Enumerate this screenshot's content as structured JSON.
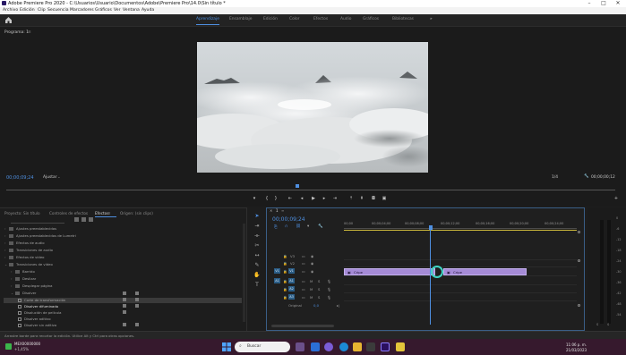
{
  "window": {
    "title": "Adobe Premiere Pro 2020 - C:\\Usuarios\\Usuario\\Documentos\\Adobe\\Premiere Pro\\14.0\\Sin título *",
    "minimize": "–",
    "maximize": "□",
    "close": "✕"
  },
  "menu": [
    "Archivo",
    "Edición",
    "Clip",
    "Secuencia",
    "Marcadores",
    "Gráficos",
    "Ver",
    "Ventana",
    "Ayuda"
  ],
  "workspaces": {
    "items": [
      "Aprendizaje",
      "Ensamblaje",
      "Edición",
      "Color",
      "Efectos",
      "Audio",
      "Gráficos",
      "Bibliotecas"
    ],
    "active_index": 0,
    "more": "»"
  },
  "program_monitor": {
    "title": "Programa: 1",
    "timecode": "00;00;09;24",
    "fit": "Ajustar",
    "resolution": "1/4",
    "duration": "00;00;00;12"
  },
  "effects_panel": {
    "tabs": [
      "Proyecto: Sin título",
      "Controles de efectos",
      "Efectos",
      "Origen: (sin clips)"
    ],
    "active_tab": 2,
    "tree": [
      {
        "label": "Ajustes preestablecidos",
        "type": "folder",
        "level": 0
      },
      {
        "label": "Ajustes preestablecidos de Lumetri",
        "type": "folder",
        "level": 0
      },
      {
        "label": "Efectos de audio",
        "type": "folder",
        "level": 0
      },
      {
        "label": "Transiciones de audio",
        "type": "folder",
        "level": 0
      },
      {
        "label": "Efectos de vídeo",
        "type": "folder",
        "level": 0
      },
      {
        "label": "Transiciones de vídeo",
        "type": "folder",
        "level": 0
      },
      {
        "label": "Barrido",
        "type": "folder",
        "level": 1
      },
      {
        "label": "Deslizar",
        "type": "folder",
        "level": 1
      },
      {
        "label": "Desplegar página",
        "type": "folder",
        "level": 1
      },
      {
        "label": "Disolver",
        "type": "folder",
        "level": 1
      },
      {
        "label": "Corte de transformación",
        "type": "effect",
        "level": 2
      },
      {
        "label": "Disolver difuminado",
        "type": "effect",
        "level": 2,
        "selected": true
      },
      {
        "label": "Disolución de película",
        "type": "effect",
        "level": 2
      },
      {
        "label": "Disolver aditivo",
        "type": "effect",
        "level": 2
      },
      {
        "label": "Disolver sin aditivo",
        "type": "effect",
        "level": 2
      }
    ]
  },
  "timeline": {
    "close": "✕",
    "sequence_name": "1",
    "timecode": "00;00;09;24",
    "ruler": [
      "00;00",
      "00;00;04;00",
      "00;00;08;00",
      "00;00;12;00",
      "00;00;16;00",
      "00;00;20;00",
      "00;00;24;00"
    ],
    "video_tracks": [
      "V3",
      "V2",
      "V1"
    ],
    "audio_tracks": [
      "A1",
      "A2",
      "A3"
    ],
    "master": "Original",
    "master_value": "0,0",
    "clips": [
      {
        "label": "Cripe",
        "track": "V1",
        "color": "#a58bd6"
      },
      {
        "label": "Cripe",
        "track": "V1",
        "color": "#a58bd6"
      }
    ]
  },
  "meters": {
    "db_labels": [
      "0",
      "-6",
      "-12",
      "-18",
      "-24",
      "-30",
      "-36",
      "-42",
      "-48",
      "-54"
    ],
    "s_label": "S",
    "s_label_2": "S"
  },
  "status": {
    "text": "Arrastre borde para recortar la edición. Utilice Alt y Ctrl para otras opciones."
  },
  "taskbar": {
    "ticker": "MEX00000000",
    "ticker_change": "+1,45%",
    "search": "Buscar",
    "time": "11:06 p. m.",
    "date": "21/03/2023"
  },
  "colors": {
    "accent_blue": "#4e8fe0",
    "clip_purple": "#a58bd6",
    "playhead": "#4e8fe0",
    "taskbar": "#36192d"
  }
}
